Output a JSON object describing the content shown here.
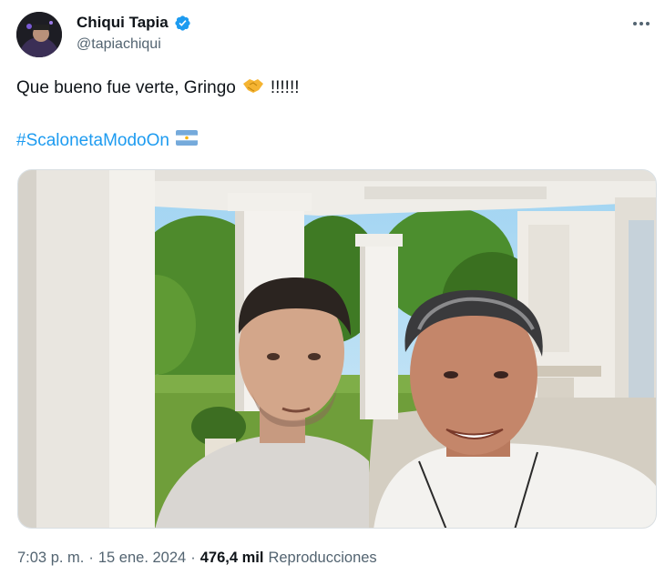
{
  "author": {
    "display_name": "Chiqui Tapia",
    "handle": "@tapiachiqui",
    "verified_icon": "verified-badge-icon",
    "avatar_icon": "avatar-photo"
  },
  "more_icon": "more-horizontal-icon",
  "body": {
    "line1_text": "Que bueno fue verte, Gringo",
    "line1_emoji": "handshake-emoji",
    "line1_suffix": "!!!!!!",
    "hashtag": "#ScalonetaModoOn",
    "flag_emoji": "argentina-flag-emoji"
  },
  "meta": {
    "time": "7:03 p. m.",
    "separator": "·",
    "date": "15 ene. 2024",
    "views_count": "476,4 mil",
    "views_label": "Reproducciones"
  },
  "colors": {
    "text": "#0f1419",
    "secondary": "#536471",
    "link": "#1d9bf0",
    "verified": "#1d9bf0"
  }
}
